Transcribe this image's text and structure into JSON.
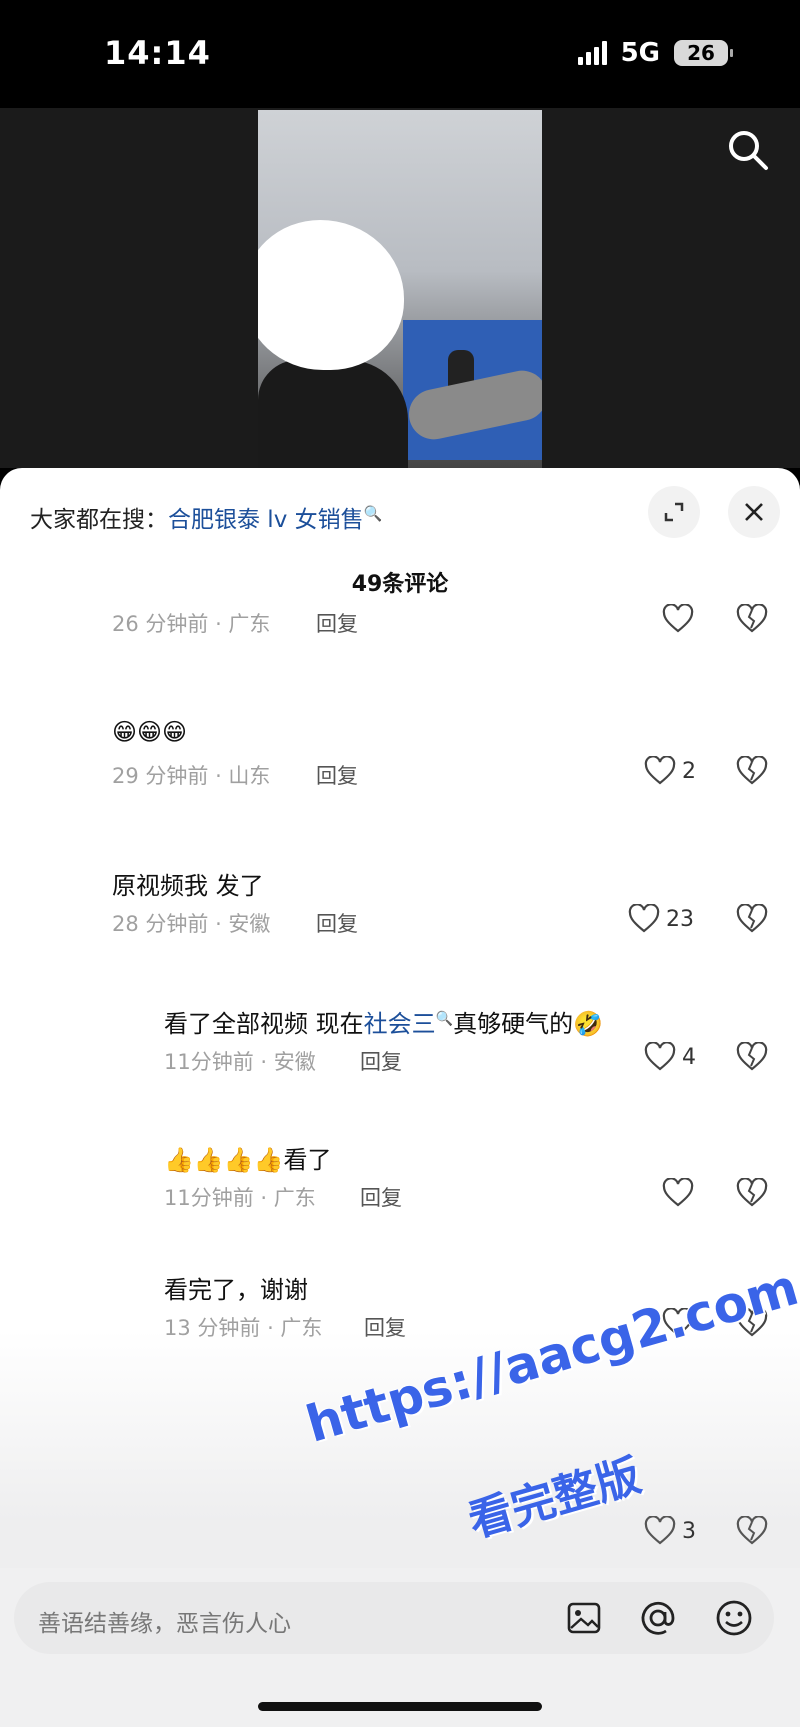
{
  "status_bar": {
    "time": "14:14",
    "network": "5G",
    "battery": "26"
  },
  "header": {
    "prefix": "大家都在搜：",
    "keyword": "合肥银泰 lv 女销售",
    "comment_count": "49条评论"
  },
  "comments": [
    {
      "text": "",
      "time_loc": "26 分钟前 · 广东",
      "reply": "回复",
      "likes": ""
    },
    {
      "text": "😁😁😁",
      "time_loc": "29 分钟前 · 山东",
      "reply": "回复",
      "likes": "2"
    },
    {
      "text": "原视频我 发了",
      "time_loc": "28 分钟前 · 安徽",
      "reply": "回复",
      "likes": "23"
    },
    {
      "text_pre": "看了全部视频 现在",
      "text_kw": "社会三",
      "text_post": "真够硬气的🤣",
      "time_loc": "11分钟前 · 安徽",
      "reply": "回复",
      "likes": "4"
    },
    {
      "text": "👍👍👍👍看了",
      "time_loc": "11分钟前 · 广东",
      "reply": "回复",
      "likes": ""
    },
    {
      "text": "看完了，谢谢",
      "time_loc": "13 分钟前 · 广东",
      "reply": "回复",
      "likes": ""
    },
    {
      "text": "",
      "time_loc": "",
      "reply": "",
      "likes": "3"
    }
  ],
  "watermark": {
    "line1": "https://aacg2.com",
    "line2": "看完整版"
  },
  "input": {
    "placeholder": "善语结善缘，恶言伤人心"
  },
  "icons": [
    "search-icon",
    "expand-icon",
    "close-icon",
    "heart-icon",
    "broken-heart-icon",
    "image-icon",
    "at-icon",
    "emoji-icon"
  ],
  "colors": {
    "keyword_blue": "#1c4f9a",
    "watermark_blue": "#3a64e8"
  }
}
